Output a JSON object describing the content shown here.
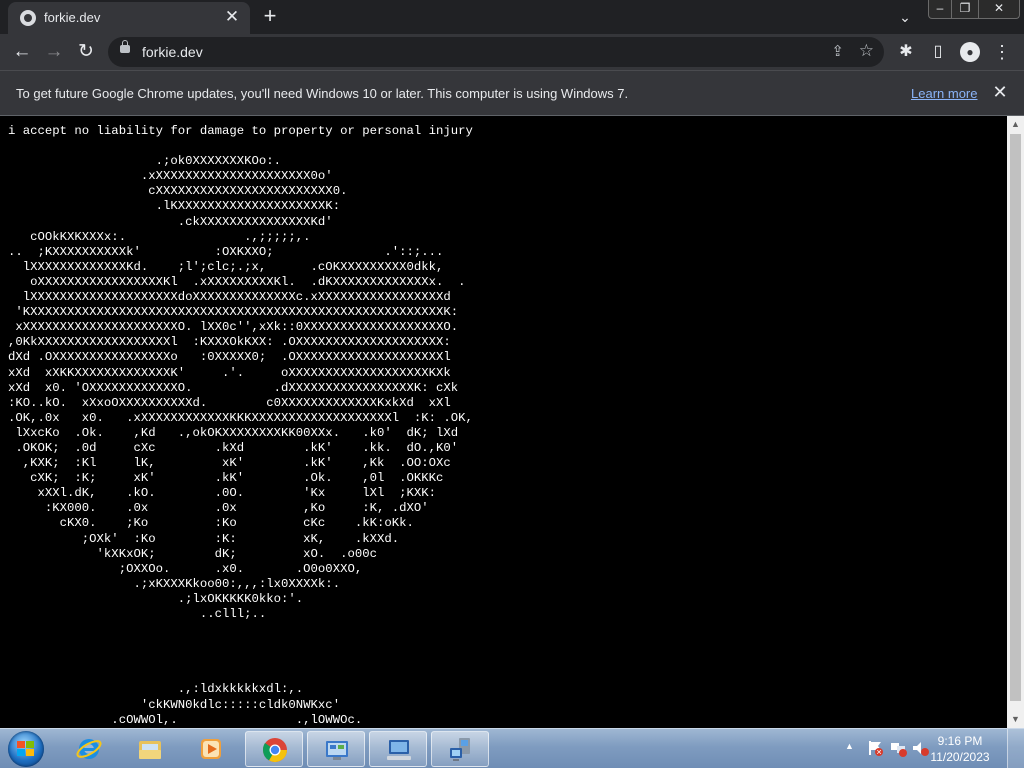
{
  "browser": {
    "tab_title": "forkie.dev",
    "url": "forkie.dev",
    "infobar_message": "To get future Google Chrome updates, you'll need Windows 10 or later. This computer is using Windows 7.",
    "infobar_link": "Learn more"
  },
  "page": {
    "disclaimer": "i accept no liability for damage to property or personal injury",
    "ascii_art": "                    .;ok0XXXXXXXKOo:.\n                  .xXXXXXXXXXXXXXXXXXXXXX0o'\n                   cXXXXXXXXXXXXXXXXXXXXXXXX0.\n                    .lKXXXXXXXXXXXXXXXXXXXXK:\n                       .ckXXXXXXXXXXXXXXXKd'\n   cOOkKXKXXXx:.                .,;;;;;,.\n..  ;KXXXXXXXXXXk'          :OXKXXO;               .'::;...\n  lXXXXXXXXXXXXXKd.    ;l';clc;.;x,      .cOKXXXXXXXXX0dkk,\n   oXXXXXXXXXXXXXXXXXKl  .xXXXXXXXXXKl.  .dKXXXXXXXXXXXXXx.  .\n  lXXXXXXXXXXXXXXXXXXXXdoXXXXXXXXXXXXXXc.xXXXXXXXXXXXXXXXXXd\n 'KXXXXXXXXXXXXXXXXXXXXXXXXXXXXXXXXXXXXXXXXXXXXXXXXXXXXXXXXK:\n xXXXXXXXXXXXXXXXXXXXXXO. lXX0c'',xXk::0XXXXXXXXXXXXXXXXXXXO.\n,0KkXXXXXXXXXXXXXXXXXXl  :KXXXOkKXX: .OXXXXXXXXXXXXXXXXXXXX:\ndXd .OXXXXXXXXXXXXXXXXo   :0XXXXX0;  .OXXXXXXXXXXXXXXXXXXXXl\nxXd  xXKKXXXXXXXXXXXXXK'     .'.     oXXXXXXXXXXXXXXXXXXXKXk\nxXd  x0. 'OXXXXXXXXXXXXO.           .dXXXXXXXXXXXXXXXXXK: cXk\n:KO..kO.  xXxoOXXXXXXXXXXd.        c0XXXXXXXXXXXXXKxkXd  xXl\n.OK,.0x   x0.   .xXXXXXXXXXXXXKKKXXXXXXXXXXXXXXXXXXXl  :K: .OK,\n lXxcKo  .Ok.    ,Kd   .,okOKXXXXXXXXKK00XXx.   .k0'  dK; lXd\n .OKOK;  .0d     cXc        .kXd        .kK'    .kk.  dO.,K0'\n  ,KXK;  :Kl     lK,         xK'        .kK'    ,Kk  .OO:OXc\n   cXK;  :K;     xK'        .kK'        .Ok.    ,0l  .OKKKc\n    xXXl.dK,    .kO.        .0O.        'Kx     lXl  ;KXK:\n     :KX000.    .0x         .0x         ,Ko     :K, .dXO'\n       cKX0.    ;Ko         :Ko         cKc    .kK:oKk.\n          ;OXk'  :Ko        :K:         xK,    .kXXd.\n            'kXKxOK;        dK;         xO.  .o00c\n               ;OXXOo.      .x0.       .O0o0XXO,\n                 .;xKXXXKkoo00:,,,:lx0XXXXk:.\n                       .;lxOKKKKK0kko:'.\n                          ..clll;..\n\n\n\n\n                       .,:ldxkkkkkxdl:,.\n                  'ckKWN0kdlc:::::cldk0NWKxc'\n              .cOWWOl,.                .,lOWWOc.\n            .:k:xo'                        'ox:k:"
  },
  "taskbar": {
    "time": "9:16 PM",
    "date": "11/20/2023",
    "apps": [
      "internet-explorer",
      "file-explorer",
      "media-player",
      "chrome",
      "control-panel",
      "remote-desktop",
      "network-tool"
    ]
  },
  "colors": {
    "page_bg": "#000000",
    "page_text": "#ffffff",
    "chrome_dark": "#202124",
    "chrome_toolbar": "#35363a",
    "link": "#8ab4f8"
  }
}
